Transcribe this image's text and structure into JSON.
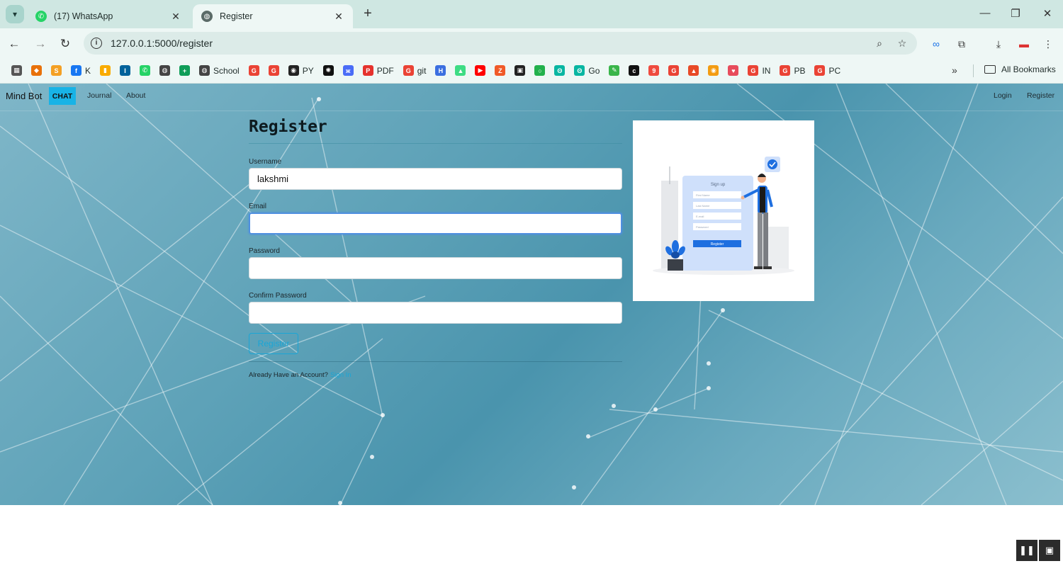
{
  "browser": {
    "tabs": [
      {
        "title": "(17) WhatsApp",
        "icon": "whatsapp-icon"
      },
      {
        "title": "Register",
        "icon": "globe-icon"
      }
    ],
    "url": "127.0.0.1:5000/register",
    "bookmarks": [
      {
        "label": "",
        "icon": "apps-grid-icon",
        "color": "#555555",
        "glyph": "▦"
      },
      {
        "label": "",
        "icon": "arrow-bookmark-icon",
        "color": "#e8710a",
        "glyph": "◆"
      },
      {
        "label": "",
        "icon": "stack-icon",
        "color": "#f4a024",
        "glyph": "S"
      },
      {
        "label": "K",
        "icon": "facebook-icon",
        "color": "#1877f2",
        "glyph": "f"
      },
      {
        "label": "",
        "icon": "analytics-icon",
        "color": "#f9ab00",
        "glyph": "▮"
      },
      {
        "label": "",
        "icon": "ieee-icon",
        "color": "#00629b",
        "glyph": "I"
      },
      {
        "label": "",
        "icon": "whatsapp-icon",
        "color": "#25d366",
        "glyph": "✆"
      },
      {
        "label": "",
        "icon": "globe-icon",
        "color": "#444444",
        "glyph": "◍"
      },
      {
        "label": "",
        "icon": "sheets-icon",
        "color": "#0f9d58",
        "glyph": "+"
      },
      {
        "label": "School",
        "icon": "globe-icon",
        "color": "#444444",
        "glyph": "◍"
      },
      {
        "label": "",
        "icon": "google-icon",
        "color": "#ea4335",
        "glyph": "G"
      },
      {
        "label": "",
        "icon": "google-icon",
        "color": "#ea4335",
        "glyph": "G"
      },
      {
        "label": "PY",
        "icon": "github-icon",
        "color": "#222222",
        "glyph": "◉"
      },
      {
        "label": "",
        "icon": "openai-icon",
        "color": "#111111",
        "glyph": "✺"
      },
      {
        "label": "",
        "icon": "butterfly-icon",
        "color": "#4a6cf7",
        "glyph": "ж"
      },
      {
        "label": "PDF",
        "icon": "pdf-icon",
        "color": "#e5322d",
        "glyph": "P"
      },
      {
        "label": "git",
        "icon": "google-icon",
        "color": "#ea4335",
        "glyph": "G"
      },
      {
        "label": "",
        "icon": "bracket-icon",
        "color": "#3b6fe0",
        "glyph": "H"
      },
      {
        "label": "",
        "icon": "android-icon",
        "color": "#3ddc84",
        "glyph": "▲"
      },
      {
        "label": "",
        "icon": "youtube-icon",
        "color": "#ff0000",
        "glyph": "▶"
      },
      {
        "label": "",
        "icon": "zed-icon",
        "color": "#f05a28",
        "glyph": "Z"
      },
      {
        "label": "",
        "icon": "archive-icon",
        "color": "#222222",
        "glyph": "▣"
      },
      {
        "label": "",
        "icon": "ring-icon",
        "color": "#22b14c",
        "glyph": "○"
      },
      {
        "label": "",
        "icon": "codeium-icon",
        "color": "#09b6a2",
        "glyph": "ʘ"
      },
      {
        "label": "Go",
        "icon": "codeium-icon",
        "color": "#09b6a2",
        "glyph": "ʘ"
      },
      {
        "label": "",
        "icon": "green-square-icon",
        "color": "#39b54a",
        "glyph": "✎"
      },
      {
        "label": "",
        "icon": "cl-icon",
        "color": "#111111",
        "glyph": "c"
      },
      {
        "label": "",
        "icon": "red-circle-icon",
        "color": "#ef4b3f",
        "glyph": "9"
      },
      {
        "label": "",
        "icon": "google-icon",
        "color": "#ea4335",
        "glyph": "G"
      },
      {
        "label": "",
        "icon": "rocket-icon",
        "color": "#e84a27",
        "glyph": "▲"
      },
      {
        "label": "",
        "icon": "eye-icon",
        "color": "#f39c12",
        "glyph": "◉"
      },
      {
        "label": "",
        "icon": "heart-icon",
        "color": "#e74c5c",
        "glyph": "♥"
      },
      {
        "label": "IN",
        "icon": "google-icon",
        "color": "#ea4335",
        "glyph": "G"
      },
      {
        "label": "PB",
        "icon": "google-icon",
        "color": "#ea4335",
        "glyph": "G"
      },
      {
        "label": "PC",
        "icon": "google-icon",
        "color": "#ea4335",
        "glyph": "G"
      }
    ],
    "more_bookmarks": "»",
    "all_bookmarks": "All Bookmarks"
  },
  "site": {
    "brand": "Mind Bot",
    "nav": {
      "chat": "CHAT",
      "journal": "Journal",
      "about": "About",
      "login": "Login",
      "register": "Register"
    },
    "form": {
      "title": "Register",
      "username_label": "Username",
      "username_value": "lakshmi",
      "email_label": "Email",
      "email_value": "",
      "password_label": "Password",
      "password_value": "",
      "confirm_label": "Confirm Password",
      "confirm_value": "",
      "submit_label": "Register",
      "already_text": "Already Have an Account?",
      "signin_link": "Sign In"
    },
    "illustration": {
      "heading": "Sign up",
      "fields": [
        "First Name",
        "Last Name",
        "E-mail",
        "Password"
      ],
      "button": "Register"
    }
  },
  "colors": {
    "accent": "#18b3e6",
    "focus": "#4f8fe0",
    "illustration_blue": "#1e6fe0"
  }
}
